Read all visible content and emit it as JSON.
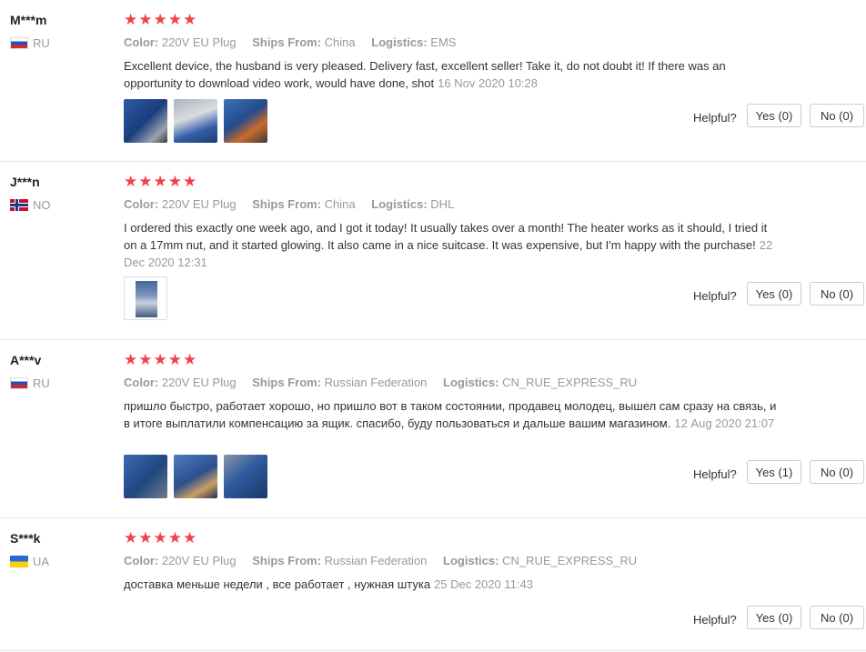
{
  "labels": {
    "color": "Color:",
    "ships_from": "Ships From:",
    "logistics": "Logistics:",
    "helpful": "Helpful?"
  },
  "rating_glyphs": "★★★★★",
  "reviews": [
    {
      "user": "M***m",
      "country": "RU",
      "flag": "ru",
      "rating": 5,
      "color": "220V EU Plug",
      "ships_from": "China",
      "logistics": "EMS",
      "text": "Excellent device, the husband is very pleased. Delivery fast, excellent seller! Take it, do not doubt it! If there was an opportunity to download video work, would have done, shot",
      "date": "16 Nov 2020 10:28",
      "photos": 3,
      "yes": "Yes (0)",
      "no": "No (0)"
    },
    {
      "user": "J***n",
      "country": "NO",
      "flag": "no",
      "rating": 5,
      "color": "220V EU Plug",
      "ships_from": "China",
      "logistics": "DHL",
      "text": "I ordered this exactly one week ago, and I got it today! It usually takes over a month! The heater works as it should, I tried it on a 17mm nut, and it started glowing. It also came in a nice suitcase. It was expensive, but I'm happy with the purchase!",
      "date": "22 Dec 2020 12:31",
      "photos": 1,
      "yes": "Yes (0)",
      "no": "No (0)"
    },
    {
      "user": "A***v",
      "country": "RU",
      "flag": "ru",
      "rating": 5,
      "color": "220V EU Plug",
      "ships_from": "Russian Federation",
      "logistics": "CN_RUE_EXPRESS_RU",
      "text": "пришло быстро, работает хорошо, но пришло вот в таком состоянии, продавец молодец, вышел сам сразу на связь, и в итоге выплатили компенсацию за ящик. спасибо, буду пользоваться и дальше вашим магазином.",
      "date": "12 Aug 2020 21:07",
      "photos": 3,
      "yes": "Yes (1)",
      "no": "No (0)"
    },
    {
      "user": "S***k",
      "country": "UA",
      "flag": "ua",
      "rating": 5,
      "color": "220V EU Plug",
      "ships_from": "Russian Federation",
      "logistics": "CN_RUE_EXPRESS_RU",
      "text": "доставка меньше недели , все работает , нужная штука",
      "date": "25 Dec 2020 11:43",
      "photos": 0,
      "yes": "Yes (0)",
      "no": "No (0)"
    }
  ],
  "colors": {
    "star": "#f0424b",
    "muted": "#999999",
    "divider": "#e8e8e8"
  }
}
